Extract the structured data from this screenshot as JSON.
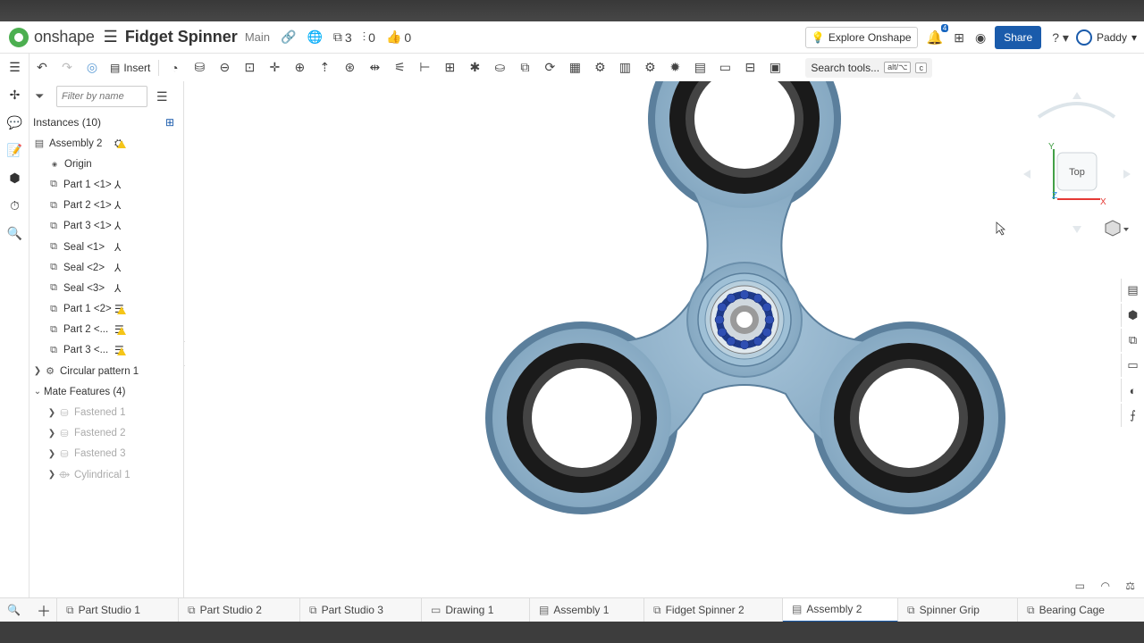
{
  "header": {
    "brand": "onshape",
    "doc_title": "Fidget Spinner",
    "branch": "Main",
    "versions": "3",
    "branches": "0",
    "likes": "0",
    "explore": "Explore Onshape",
    "notif_count": "4",
    "share": "Share",
    "user": "Paddy"
  },
  "toolbar": {
    "insert": "Insert",
    "search_tools": "Search tools...",
    "shortcut_key": "alt/⌥",
    "shortcut_c": "c"
  },
  "panel": {
    "filter_placeholder": "Filter by name",
    "instances_header": "Instances (10)",
    "items": [
      {
        "label": "Assembly 2",
        "icon": "assembly-icon"
      },
      {
        "label": "Origin",
        "icon": "origin-icon"
      },
      {
        "label": "Part 1 <1>",
        "icon": "part-icon"
      },
      {
        "label": "Part 2 <1>",
        "icon": "part-icon"
      },
      {
        "label": "Part 3 <1>",
        "icon": "part-icon"
      },
      {
        "label": "Seal <1>",
        "icon": "part-icon"
      },
      {
        "label": "Seal <2>",
        "icon": "part-icon"
      },
      {
        "label": "Seal <3>",
        "icon": "part-icon"
      },
      {
        "label": "Part 1 <2>",
        "icon": "part-icon"
      },
      {
        "label": "Part 2 <...",
        "icon": "part-icon"
      },
      {
        "label": "Part 3 <...",
        "icon": "part-icon"
      }
    ],
    "pattern": "Circular pattern 1",
    "mate_header": "Mate Features (4)",
    "mates": [
      "Fastened 1",
      "Fastened 2",
      "Fastened 3",
      "Cylindrical 1"
    ]
  },
  "viewcube": {
    "face": "Top",
    "axis_y": "Y",
    "axis_z": "Z",
    "axis_x": "X"
  },
  "tabs": [
    "Part Studio 1",
    "Part Studio 2",
    "Part Studio 3",
    "Drawing 1",
    "Assembly 1",
    "Fidget Spinner 2",
    "Assembly 2",
    "Spinner Grip",
    "Bearing Cage"
  ],
  "active_tab": "Assembly 2",
  "colors": {
    "spinner_body": "#8fb3cc",
    "spinner_edge": "#5b7f9c",
    "seal": "#1a1a1a",
    "balls": "#1e3a8a",
    "accent": "#1a5bab"
  }
}
